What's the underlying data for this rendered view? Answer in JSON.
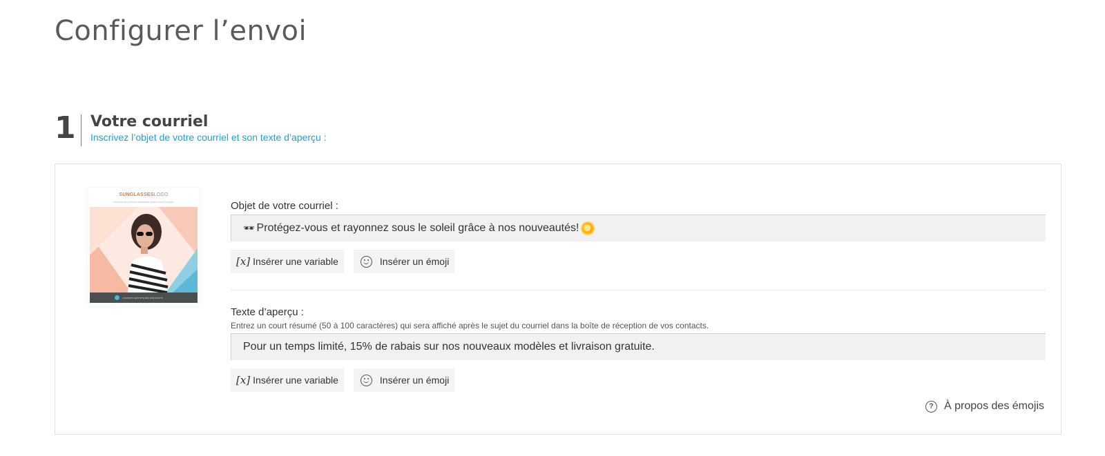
{
  "page": {
    "title": "Configurer l’envoi"
  },
  "step": {
    "number": "1",
    "title": "Votre courriel",
    "subtitle": "Inscrivez l’objet de votre courriel et son texte d’aperçu :"
  },
  "thumbnail": {
    "logo_brand": "SUNGLASSES",
    "logo_suffix": "LOGO",
    "tagline": "NOUVEAUTÉS STRAND SWIMWEAR SPORT CARTE CADEAU",
    "footer_text": "LIVRAISON GRATUITE DÈS 100$ ACHATS"
  },
  "subject": {
    "label": "Objet de votre courriel :",
    "emoji_prefix": "🕶",
    "value": "Protégez-vous et rayonnez sous le soleil grâce à nos nouveautés!",
    "emoji_suffix_icon": "sun-icon"
  },
  "preview": {
    "label": "Texte d’aperçu :",
    "help": "Entrez un court résumé (50 à 100 caractères) qui sera affiché après le sujet du courriel dans la boîte de réception de vos contacts.",
    "value": "Pour un temps limité, 15% de rabais sur nos nouveaux modèles et livraison gratuite."
  },
  "tools": {
    "variable_icon": "[x]",
    "insert_variable": "Insérer une variable",
    "insert_emoji": "Insérer un émoji"
  },
  "about": {
    "q_icon": "?",
    "label": "À propos des émojis"
  },
  "colors": {
    "accent": "#1aa3d6",
    "field_bg": "#f1f1f1"
  }
}
